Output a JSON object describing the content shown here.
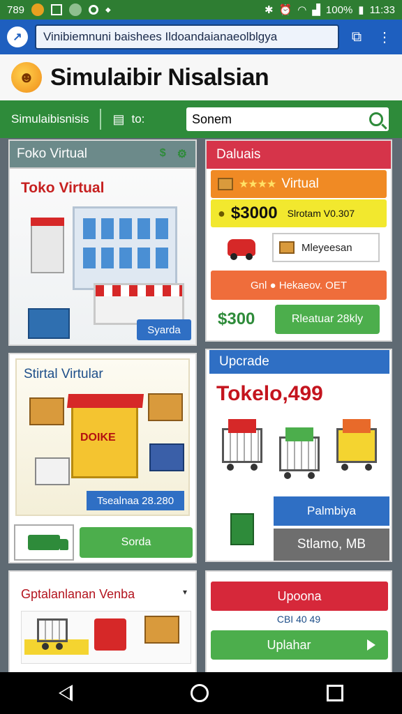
{
  "status_bar": {
    "time_left": "789",
    "battery": "100%",
    "time_right": "11:33"
  },
  "browser": {
    "url": "Vinibiemnuni baishees Ildoandaianaeolblgya"
  },
  "app": {
    "title": "Simulaibir Nisalsian"
  },
  "toolbar": {
    "label": "Simulaibisnisis",
    "to_label": "to:",
    "search_value": "Sonem"
  },
  "card_store": {
    "header": "Foko Virtual",
    "subtitle": "Toko Virtual",
    "button": "Syarda"
  },
  "card_details": {
    "header": "Daluais",
    "rating_label": "Virtual",
    "stars": "★★★★",
    "price": "$3000",
    "price_note": "Slrotam V0.307",
    "message": "Mleyeesan",
    "offer": "Gnl  ●  Hekaeov. OET",
    "price2": "$300",
    "button": "Rleatuar 28kly"
  },
  "card_stall": {
    "title": "Stirtal Virtular",
    "stall_label": "DOIKE",
    "tag": "Tsealnaa 28.280",
    "button": "Sorda"
  },
  "card_upgrade": {
    "header": "Upcrade",
    "price": "Tokelo,499",
    "button1": "Palmbiya",
    "button2": "Stlamo, MB"
  },
  "card_wholesale": {
    "title": "Gptalanlanan Venba",
    "caret": "▾"
  },
  "card_upgrade2": {
    "button1": "Upoona",
    "code": "CBI 40 49",
    "button2": "Uplahar"
  },
  "colors": {
    "status_green": "#2e7d32",
    "browser_blue": "#1e5fbf",
    "toolbar_green": "#2e8b3a",
    "accent_red": "#d6344a",
    "button_green": "#4cae4c",
    "button_blue": "#2f6fc4"
  },
  "icons": [
    "wifi-icon",
    "signal-icon",
    "battery-icon",
    "bluetooth-icon",
    "alarm-icon",
    "share-icon",
    "more-icon",
    "search-icon",
    "cashier-icon",
    "back-icon",
    "home-icon",
    "recents-icon"
  ]
}
